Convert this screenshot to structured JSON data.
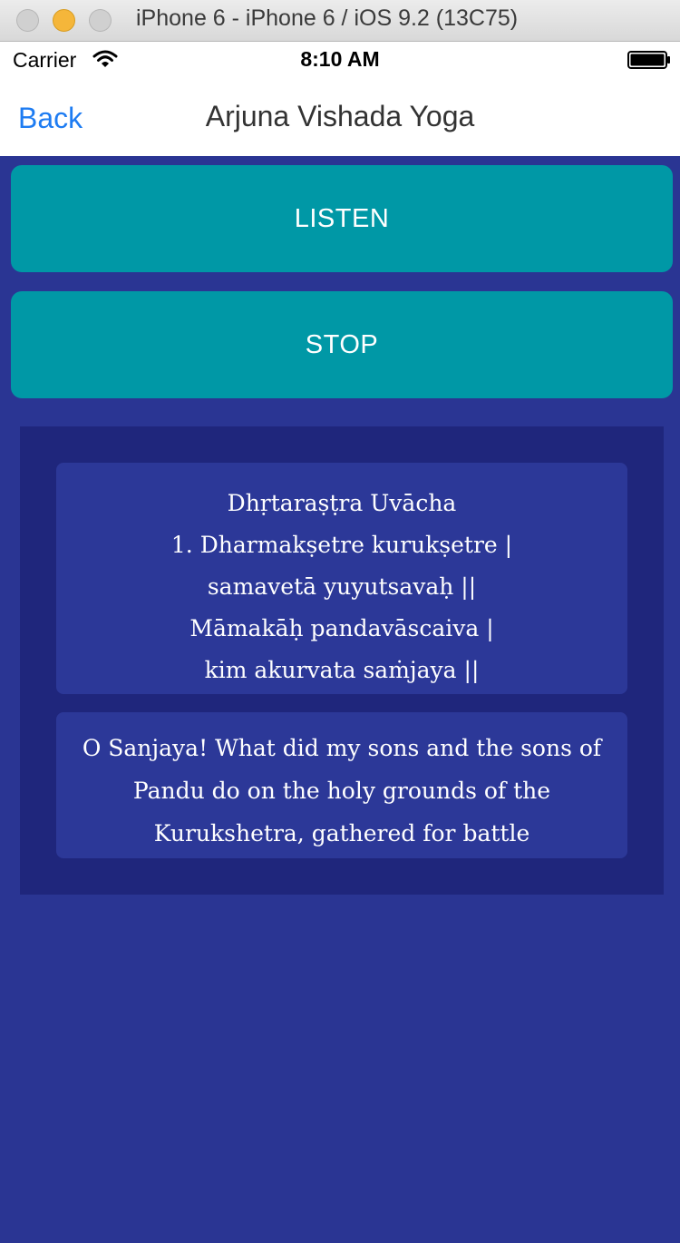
{
  "window": {
    "title": "iPhone 6 - iPhone 6 / iOS 9.2 (13C75)"
  },
  "status_bar": {
    "carrier": "Carrier",
    "time": "8:10 AM"
  },
  "nav": {
    "back_label": "Back",
    "title": "Arjuna Vishada Yoga"
  },
  "buttons": {
    "listen_label": "LISTEN",
    "stop_label": "STOP"
  },
  "verse": {
    "lines": [
      "Dhṛtaraṣṭra Uvācha",
      "1.  Dharmakṣetre kurukṣetre  |",
      "samavetā yuyutsavaḥ  ||",
      "Māmakāḥ pandavāscaiva  |",
      "kim akurvata saṁjaya  ||"
    ],
    "translation": "O Sanjaya! What did my sons and the sons of Pandu do on the holy grounds of the Kurukshetra, gathered for battle"
  },
  "colors": {
    "background": "#2a3593",
    "button": "#0098a6",
    "panel": "#1f267c",
    "card": "#2c3898",
    "link": "#1e7cf2"
  },
  "icons": {
    "wifi": "wifi-icon",
    "battery": "battery-icon"
  }
}
